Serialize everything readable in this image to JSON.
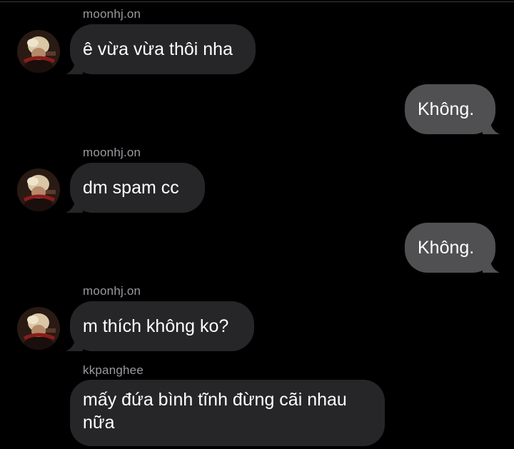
{
  "conversation": {
    "messages": [
      {
        "sender": "moonhj.on",
        "text": "ê vừa vừa thôi nha"
      },
      {
        "text": "Không."
      },
      {
        "sender": "moonhj.on",
        "text": "dm spam cc"
      },
      {
        "text": "Không."
      },
      {
        "sender": "moonhj.on",
        "text": "m thích không ko?"
      },
      {
        "sender": "kkpanghee",
        "text": "mấy đứa bình tĩnh đừng cãi nhau nữa"
      }
    ]
  },
  "colors": {
    "background": "#000000",
    "incoming_bubble": "#262628",
    "outgoing_bubble": "#505052",
    "sender_label": "#9a9aa0",
    "text": "#ffffff"
  },
  "icons": {
    "avatar": "user-avatar-photo"
  }
}
